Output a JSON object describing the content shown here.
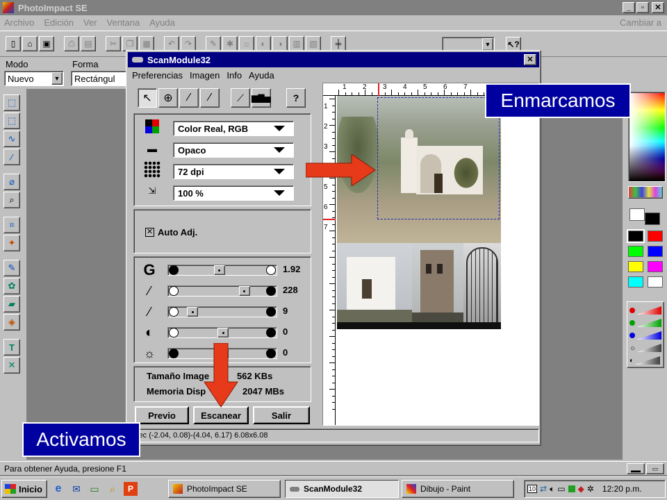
{
  "app": {
    "title": "PhotoImpact SE",
    "menu": [
      "Archivo",
      "Edición",
      "Ver",
      "Ventana",
      "Ayuda"
    ],
    "menu_right": "Cambiar a",
    "modo_label": "Modo",
    "modo_value": "Nuevo",
    "forma_label": "Forma",
    "forma_value": "Rectángul",
    "status": "Para obtener Ayuda, presione F1"
  },
  "scan": {
    "title": "ScanModule32",
    "menu": [
      "Preferencias",
      "Imagen",
      "Info",
      "Ayuda"
    ],
    "color_mode": "Color Real, RGB",
    "media": "Opaco",
    "resolution": "72 dpi",
    "scale": "100 %",
    "auto_adj": "Auto Adj.",
    "sliders": [
      {
        "icon": "G",
        "value": "1.92",
        "pos": 0.45
      },
      {
        "icon": "eyedropper-black",
        "value": "228",
        "pos": 0.78
      },
      {
        "icon": "eyedropper-gray",
        "value": "9",
        "pos": 0.1
      },
      {
        "icon": "contrast",
        "value": "0",
        "pos": 0.5
      },
      {
        "icon": "brightness",
        "value": "0",
        "pos": 0.5
      }
    ],
    "size_label": "Tamaño Image",
    "size_value": "562 KBs",
    "mem_label": "Memoria Disp",
    "mem_value": "2047 MBs",
    "btn_preview": "Previo",
    "btn_scan": "Escanear",
    "btn_exit": "Salir",
    "status": "elec (-2.04, 0.08)-(4.04, 6.17) 6.08x6.08",
    "ruler_numbers": [
      "1",
      "2",
      "3",
      "4",
      "5",
      "6",
      "7"
    ]
  },
  "annotations": {
    "frame": "Enmarcamos",
    "activate": "Activamos"
  },
  "taskbar": {
    "start": "Inicio",
    "tasks": [
      "PhotoImpact SE",
      "ScanModule32",
      "Dibujo - Paint"
    ],
    "clock": "12:20 p.m.",
    "tray_badge": "10"
  },
  "colors": {
    "titlebar": "#000080",
    "annotation_box": "#0000a0",
    "arrow": "#e63a1a"
  }
}
